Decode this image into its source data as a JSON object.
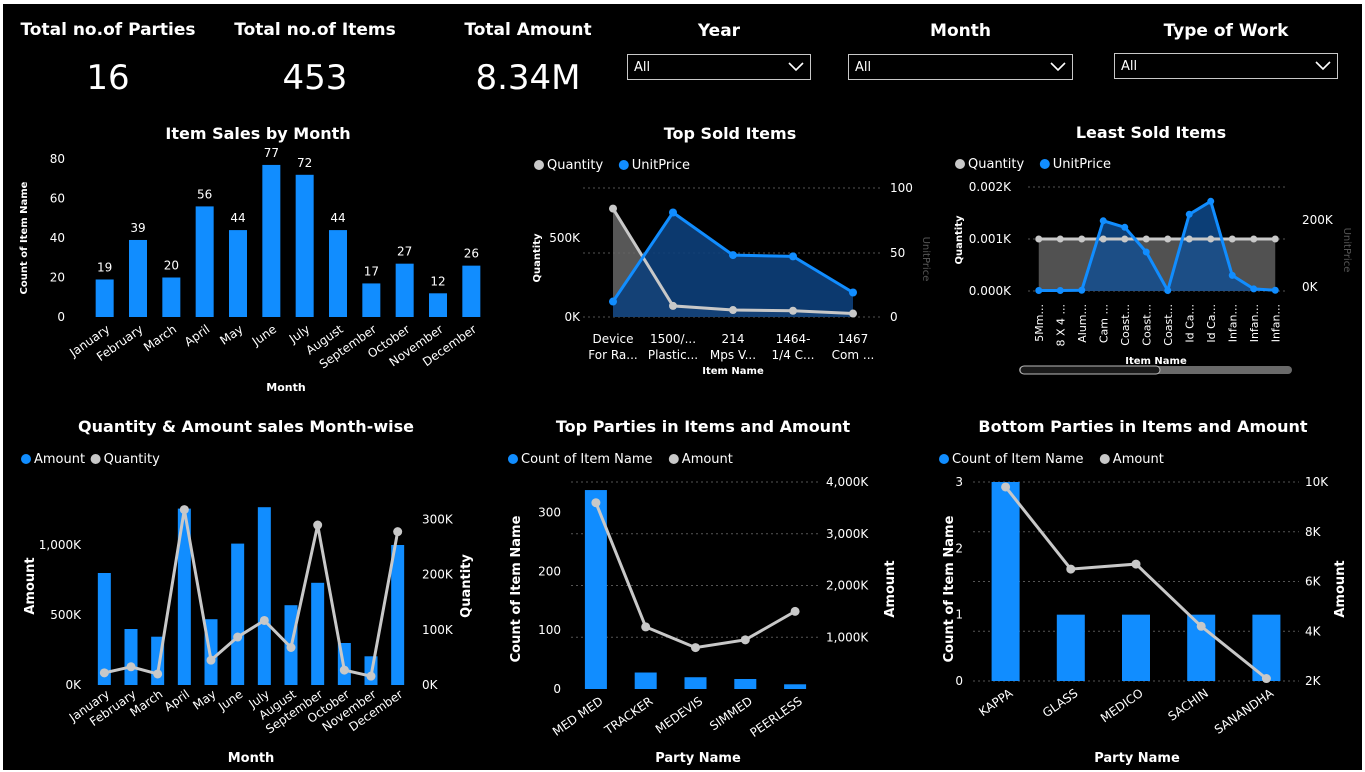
{
  "kpis": {
    "parties_label": "Total no.of Parties",
    "parties_value": "16",
    "items_label": "Total no.of Items",
    "items_value": "453",
    "amount_label": "Total Amount",
    "amount_value": "8.34M"
  },
  "slicers": {
    "year": {
      "title": "Year",
      "value": "All"
    },
    "month": {
      "title": "Month",
      "value": "All"
    },
    "type_of_work": {
      "title": "Type of Work",
      "value": "All"
    }
  },
  "colors": {
    "blue": "#118DFF",
    "gray": "#C8C8C8",
    "axis_text": "#FFFFFF"
  },
  "chart_data": [
    {
      "id": "item-sales-by-month",
      "type": "bar",
      "title": "Item Sales by Month",
      "xlabel": "Month",
      "ylabel": "Count of Item Name",
      "ylim": [
        0,
        80
      ],
      "yticks": [
        "0",
        "20",
        "40",
        "60",
        "80"
      ],
      "categories": [
        "January",
        "February",
        "March",
        "April",
        "May",
        "June",
        "July",
        "August",
        "September",
        "October",
        "November",
        "December"
      ],
      "values": [
        19,
        39,
        20,
        56,
        44,
        77,
        72,
        44,
        17,
        27,
        12,
        26
      ],
      "data_labels": true
    },
    {
      "id": "top-sold-items",
      "type": "area",
      "title": "Top Sold Items",
      "xlabel": "Item Name",
      "ylabel": "Quantity",
      "y2label": "UnitPrice",
      "legend": [
        "Quantity",
        "UnitPrice"
      ],
      "categories": [
        "Device For Ra...",
        "1500/... Plastic...",
        "214 Mps V...",
        "1464- 1/4 C...",
        "1467 Com ..."
      ],
      "yticks": [
        "0K",
        "500K"
      ],
      "y2ticks": [
        "0",
        "50",
        "100"
      ],
      "ylim": [
        0,
        1000000
      ],
      "y2lim": [
        0,
        100
      ],
      "series": [
        {
          "name": "Quantity",
          "values": [
            780000,
            80000,
            50000,
            45000,
            25000
          ]
        },
        {
          "name": "UnitPrice",
          "values": [
            12,
            81,
            48,
            47,
            19
          ]
        }
      ]
    },
    {
      "id": "least-sold-items",
      "type": "area",
      "title": "Least Sold Items",
      "xlabel": "Item Name",
      "ylabel": "Quantity",
      "y2label": "UnitPrice",
      "legend": [
        "Quantity",
        "UnitPrice"
      ],
      "categories": [
        "5Mm...",
        "8 X 4 ...",
        "Alum...",
        "Cam ...",
        "Coast...",
        "Coast...",
        "Coast...",
        "Id Ca...",
        "Id Ca...",
        "Infan...",
        "Infan...",
        "Infan..."
      ],
      "yticks": [
        "0.000K",
        "0.001K",
        "0.002K"
      ],
      "y2ticks": [
        "0K",
        "200K"
      ],
      "ylim": [
        0,
        0.002
      ],
      "y2lim": [
        0,
        400000
      ],
      "series": [
        {
          "name": "Quantity",
          "values": [
            0.001,
            0.001,
            0.001,
            0.001,
            0.001,
            0.001,
            0.001,
            0.001,
            0.001,
            0.001,
            0.001,
            0.001
          ]
        },
        {
          "name": "UnitPrice",
          "values": [
            2000,
            2000,
            3000,
            270000,
            245000,
            150000,
            2000,
            295000,
            345000,
            60000,
            8000,
            3000
          ]
        }
      ]
    },
    {
      "id": "quantity-amount-month-wise",
      "type": "bar",
      "title": "Quantity & Amount sales Month-wise",
      "xlabel": "Month",
      "ylabel": "Amount",
      "y2label": "Quantity",
      "legend": [
        "Amount",
        "Quantity"
      ],
      "categories": [
        "January",
        "February",
        "March",
        "April",
        "May",
        "June",
        "July",
        "August",
        "September",
        "October",
        "November",
        "December"
      ],
      "yticks": [
        "0K",
        "500K",
        "1,000K"
      ],
      "y2ticks": [
        "0K",
        "100K",
        "200K",
        "300K"
      ],
      "ylim": [
        0,
        1300000
      ],
      "y2lim": [
        0,
        330000
      ],
      "series": [
        {
          "name": "Amount",
          "kind": "bar",
          "values": [
            800000,
            400000,
            345000,
            1260000,
            470000,
            1010000,
            1270000,
            570000,
            730000,
            300000,
            205000,
            1000000
          ]
        },
        {
          "name": "Quantity",
          "kind": "line",
          "values": [
            22000,
            33000,
            20000,
            318000,
            45000,
            87000,
            117000,
            68000,
            290000,
            27000,
            16000,
            278000
          ]
        }
      ]
    },
    {
      "id": "top-parties",
      "type": "bar",
      "title": "Top Parties in Items and Amount",
      "xlabel": "Party Name",
      "ylabel": "Count of Item Name",
      "y2label": "Amount",
      "legend": [
        "Count of Item Name",
        "Amount"
      ],
      "categories": [
        "MED MED",
        "TRACKER",
        "MEDEVIS",
        "SIMMED",
        "PEERLESS"
      ],
      "yticks": [
        "0",
        "100",
        "200",
        "300"
      ],
      "y2ticks": [
        "1,000K",
        "2,000K",
        "3,000K",
        "4,000K"
      ],
      "ylim": [
        0,
        350
      ],
      "y2lim": [
        0,
        4000000
      ],
      "series": [
        {
          "name": "Count of Item Name",
          "kind": "bar",
          "values": [
            338,
            28,
            20,
            17,
            8
          ]
        },
        {
          "name": "Amount",
          "kind": "line",
          "values": [
            3600000,
            1200000,
            800000,
            950000,
            1500000
          ]
        }
      ]
    },
    {
      "id": "bottom-parties",
      "type": "bar",
      "title": "Bottom Parties in Items and Amount",
      "xlabel": "Party Name",
      "ylabel": "Count of Item Name",
      "y2label": "Amount",
      "legend": [
        "Count of Item Name",
        "Amount"
      ],
      "categories": [
        "KAPPA",
        "GLASS",
        "MEDICO",
        "SACHIN",
        "SANANDHA"
      ],
      "yticks": [
        "0",
        "1",
        "2",
        "3"
      ],
      "y2ticks": [
        "2K",
        "4K",
        "6K",
        "8K",
        "10K"
      ],
      "ylim": [
        0,
        3
      ],
      "y2lim": [
        2000,
        10000
      ],
      "series": [
        {
          "name": "Count of Item Name",
          "kind": "bar",
          "values": [
            3,
            1,
            1,
            1,
            1
          ]
        },
        {
          "name": "Amount",
          "kind": "line",
          "values": [
            9800,
            6500,
            6700,
            4200,
            2100
          ]
        }
      ]
    }
  ]
}
